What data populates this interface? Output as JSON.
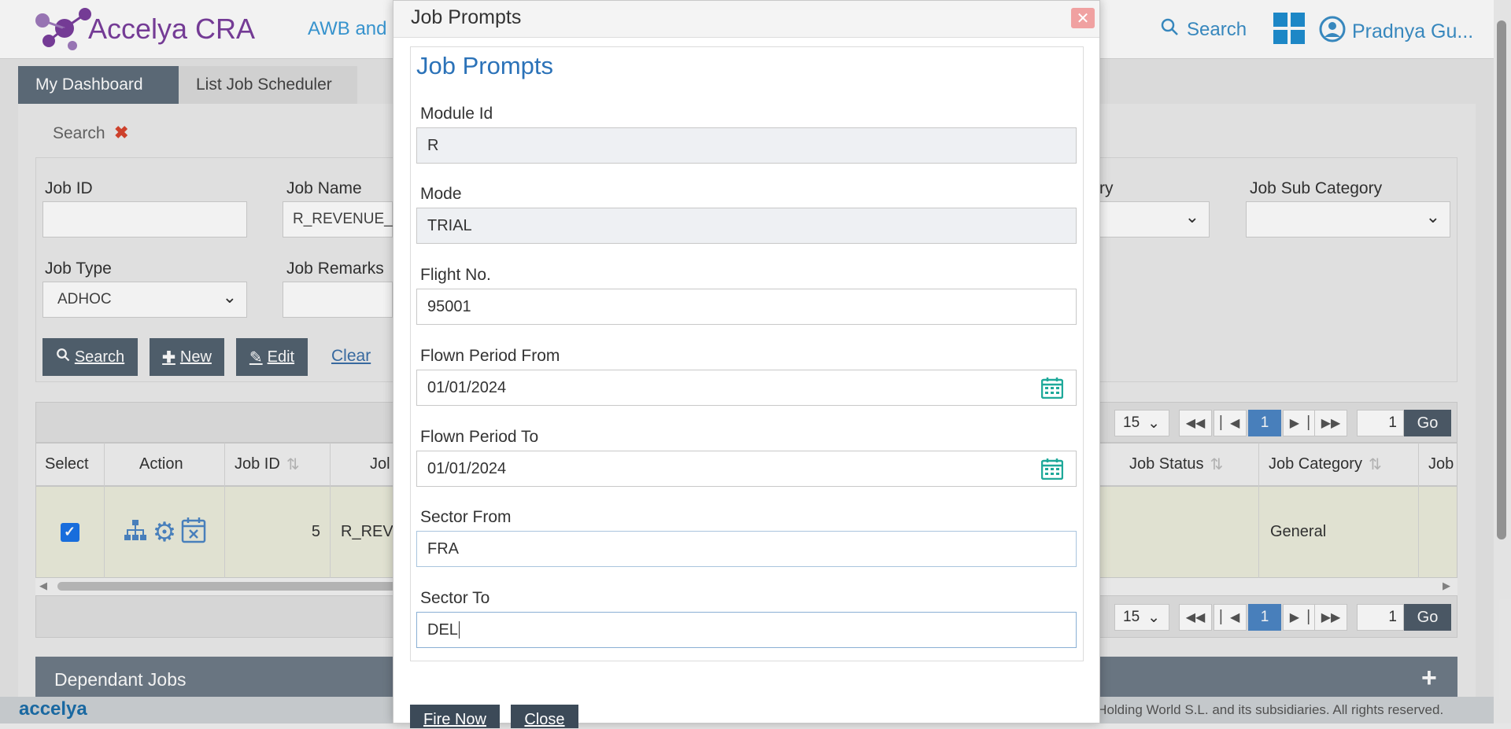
{
  "header": {
    "app_name": "Accelya CRA",
    "nav_item": "AWB and",
    "search_label": "Search",
    "user_name": "Pradnya Gu..."
  },
  "tabs": [
    {
      "label": "My Dashboard",
      "active": true
    },
    {
      "label": "List Job Scheduler",
      "active": false
    }
  ],
  "search_panel": {
    "title": "Search",
    "fields": {
      "job_id": {
        "label": "Job ID",
        "value": ""
      },
      "job_name": {
        "label": "Job Name",
        "value": "R_REVENUE_A"
      },
      "job_category_partial": {
        "label": "ry",
        "value": ""
      },
      "job_sub_category": {
        "label": "Job Sub Category",
        "value": ""
      },
      "job_type": {
        "label": "Job Type",
        "value": "ADHOC"
      },
      "job_remarks": {
        "label": "Job Remarks",
        "value": ""
      }
    },
    "buttons": {
      "search": "Search",
      "new": "New",
      "edit": "Edit",
      "clear": "Clear"
    }
  },
  "grid": {
    "page_size": "15",
    "current_page": "1",
    "goto_page": "1",
    "go_label": "Go",
    "columns": {
      "select": "Select",
      "action": "Action",
      "job_id": "Job ID",
      "job_name_partial": "Jol",
      "job_status": "Job Status",
      "job_category": "Job Category",
      "job_extra": "Job"
    },
    "rows": [
      {
        "selected": true,
        "job_id": "5",
        "job_name": "R_REVI",
        "job_status": "",
        "job_category": "General"
      }
    ]
  },
  "dependant_jobs": {
    "title": "Dependant Jobs"
  },
  "footer": {
    "logo": "accelya",
    "copyright": "a Holding World S.L. and its subsidiaries. All rights reserved."
  },
  "modal": {
    "title": "Job Prompts",
    "heading": "Job Prompts",
    "fields": {
      "module_id": {
        "label": "Module Id",
        "value": "R"
      },
      "mode": {
        "label": "Mode",
        "value": "TRIAL"
      },
      "flight_no": {
        "label": "Flight No.",
        "value": "95001"
      },
      "flown_from": {
        "label": "Flown Period From",
        "value": "01/01/2024"
      },
      "flown_to": {
        "label": "Flown Period To",
        "value": "01/01/2024"
      },
      "sector_from": {
        "label": "Sector From",
        "value": "FRA"
      },
      "sector_to": {
        "label": "Sector To",
        "value": "DEL"
      }
    },
    "buttons": {
      "fire_now": "Fire Now",
      "close": "Close"
    }
  },
  "colors": {
    "brand_purple": "#7b3f9e",
    "accent_blue": "#2b72b8",
    "dark_button": "#536270",
    "calendar_teal": "#1fa99a"
  }
}
